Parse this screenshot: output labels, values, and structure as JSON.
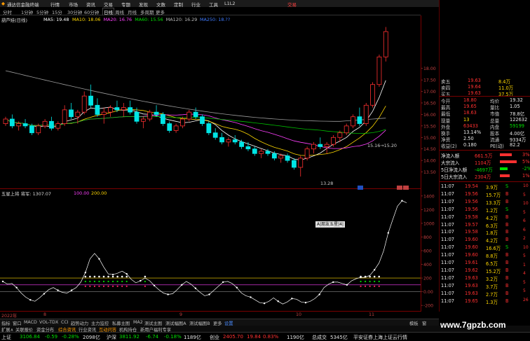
{
  "title_bar": {
    "app_title": "通达信金融终端",
    "menus": [
      "行情",
      "市场",
      "资讯",
      "交易",
      "专题",
      "发现",
      "文数",
      "定制",
      "行业",
      "工具",
      "L1L2"
    ],
    "trade": "交易"
  },
  "period_bar": {
    "items": [
      "分时",
      "1分钟",
      "5分钟",
      "15分",
      "30分钟",
      "60分钟",
      "日线",
      "周线",
      "月线",
      "多周期",
      "更多"
    ],
    "active": "日线"
  },
  "ma_legend": {
    "name": "葫芦娃(日线)",
    "items": [
      {
        "text": "MA5: 19.48",
        "color": "#ffffff"
      },
      {
        "text": "MA10: 18.06",
        "color": "#ffd800"
      },
      {
        "text": "MA20: 16.76",
        "color": "#ff40ff"
      },
      {
        "text": "MA60: 15.56",
        "color": "#00e000"
      },
      {
        "text": "MA120: 16.29",
        "color": "#bbbbbb"
      },
      {
        "text": "MA250: 18.??",
        "color": "#3f7bff"
      }
    ]
  },
  "main_chart": {
    "low_label": "13.28",
    "range_label": "15.16→15.20",
    "price_ticks": [
      "18.00",
      "17.50",
      "17.00",
      "16.50",
      "16.00",
      "15.50",
      "15.00",
      "14.50",
      "14.00",
      "13.50"
    ],
    "candles": [
      [
        15.6,
        15.9,
        15.5,
        15.8
      ],
      [
        15.8,
        16.0,
        15.4,
        15.5
      ],
      [
        15.5,
        15.7,
        15.3,
        15.6
      ],
      [
        15.6,
        15.8,
        15.4,
        15.5
      ],
      [
        15.5,
        15.6,
        15.1,
        15.2
      ],
      [
        15.2,
        15.6,
        15.1,
        15.5
      ],
      [
        15.5,
        15.8,
        15.4,
        15.7
      ],
      [
        15.7,
        15.9,
        15.3,
        15.4
      ],
      [
        15.4,
        15.7,
        15.3,
        15.6
      ],
      [
        15.6,
        16.4,
        15.5,
        16.2
      ],
      [
        16.2,
        16.5,
        15.8,
        15.9
      ],
      [
        15.9,
        16.2,
        15.6,
        16.1
      ],
      [
        16.1,
        17.0,
        16.0,
        16.8
      ],
      [
        16.8,
        17.3,
        16.3,
        16.4
      ],
      [
        16.4,
        16.7,
        15.9,
        16.0
      ],
      [
        16.0,
        16.3,
        15.6,
        16.1
      ],
      [
        16.1,
        16.4,
        15.9,
        16.3
      ],
      [
        16.3,
        16.6,
        16.1,
        16.2
      ],
      [
        16.2,
        16.5,
        15.9,
        16.3
      ],
      [
        16.3,
        16.6,
        16.0,
        16.1
      ],
      [
        16.1,
        16.3,
        15.6,
        15.7
      ],
      [
        15.7,
        15.9,
        15.4,
        15.8
      ],
      [
        15.8,
        16.2,
        15.7,
        16.1
      ],
      [
        16.1,
        16.4,
        15.9,
        16.0
      ],
      [
        16.0,
        16.1,
        15.5,
        15.6
      ],
      [
        15.6,
        15.7,
        15.2,
        15.3
      ],
      [
        15.3,
        15.6,
        15.2,
        15.5
      ],
      [
        15.5,
        15.9,
        15.4,
        15.8
      ],
      [
        15.8,
        16.2,
        15.7,
        16.1
      ],
      [
        16.1,
        16.3,
        15.8,
        15.9
      ],
      [
        15.9,
        16.0,
        15.5,
        15.6
      ],
      [
        15.6,
        15.7,
        15.1,
        15.2
      ],
      [
        15.2,
        15.4,
        14.9,
        15.0
      ],
      [
        15.0,
        15.2,
        14.7,
        14.8
      ],
      [
        14.8,
        15.0,
        14.6,
        14.9
      ],
      [
        14.9,
        15.1,
        14.7,
        14.8
      ],
      [
        14.8,
        14.9,
        14.5,
        14.6
      ],
      [
        14.6,
        14.8,
        14.4,
        14.5
      ],
      [
        14.5,
        14.6,
        14.2,
        14.3
      ],
      [
        14.3,
        14.5,
        14.1,
        14.4
      ],
      [
        14.4,
        14.5,
        14.2,
        14.3
      ],
      [
        14.3,
        14.4,
        14.0,
        14.1
      ],
      [
        14.1,
        14.3,
        13.9,
        14.2
      ],
      [
        14.2,
        14.3,
        13.9,
        14.0
      ],
      [
        14.0,
        14.1,
        13.6,
        13.7
      ],
      [
        13.7,
        14.2,
        13.3,
        14.1
      ],
      [
        14.1,
        14.6,
        14.0,
        14.5
      ],
      [
        14.5,
        14.8,
        14.3,
        14.7
      ],
      [
        14.7,
        15.0,
        14.5,
        14.6
      ],
      [
        14.6,
        14.8,
        14.3,
        14.7
      ],
      [
        14.7,
        15.1,
        14.6,
        15.0
      ],
      [
        15.0,
        15.3,
        14.8,
        15.2
      ],
      [
        15.2,
        15.6,
        15.1,
        15.5
      ],
      [
        15.5,
        16.0,
        15.4,
        15.9
      ],
      [
        15.9,
        16.3,
        15.5,
        15.6
      ],
      [
        15.6,
        16.5,
        15.5,
        16.4
      ],
      [
        16.4,
        17.4,
        16.3,
        17.3
      ],
      [
        17.3,
        18.6,
        17.2,
        18.5
      ],
      [
        18.5,
        19.8,
        18.3,
        19.6
      ]
    ]
  },
  "sub_chart": {
    "name": "五星上将",
    "label_1": "将军: 1307.07",
    "label_2": "100.00",
    "label_3": "200.00",
    "label_4": "0.00",
    "popup": "A|朋友五星|4|",
    "ticks": [
      "1400",
      "1200",
      "1000",
      "800",
      "600",
      "400",
      "200",
      "0.00",
      "-200"
    ],
    "values": [
      150,
      110,
      120,
      60,
      -20,
      -80,
      -120,
      -140,
      -90,
      -30,
      30,
      60,
      20,
      -10,
      -20,
      20,
      60,
      140,
      280,
      480,
      560,
      480,
      360,
      260,
      250,
      270,
      300,
      260,
      180,
      130,
      160,
      200,
      160,
      90,
      30,
      -20,
      -40,
      -30,
      30,
      100,
      150,
      110,
      50,
      -10,
      -60,
      -40,
      20,
      80,
      140,
      150,
      120,
      60,
      -20,
      -60,
      -80,
      -120,
      -160,
      -170,
      -140,
      -90,
      -140,
      -180,
      -150,
      -100,
      -110,
      -150,
      -160,
      -140,
      -100,
      -40,
      60,
      110,
      140,
      140,
      120,
      100,
      160,
      190,
      210,
      210,
      240,
      320,
      420,
      600,
      860,
      1060,
      1250,
      1330,
      1300
    ]
  },
  "date_axis": [
    "2022年",
    "8",
    "9",
    "10",
    "11"
  ],
  "bottom_tabs": [
    "指标",
    "窗口",
    "MACD",
    "VOL-TDX",
    "CCI",
    "趋势动力",
    "主力监控",
    "私募主图",
    "MA2",
    "测试主图",
    "测试幅图A",
    "测试幅图B",
    "更多",
    "设置"
  ],
  "tools_bar": [
    "扩展∧",
    "关联报价",
    "资金分布",
    "综合资讯",
    "行业资讯",
    "互动问答",
    "机构持仓",
    "新用户福利专享"
  ],
  "right_tabs": [
    "模板",
    "窗"
  ],
  "quote": {
    "order_book": [
      {
        "label": "卖五",
        "price": "19.63",
        "vol": "8.4万"
      },
      {
        "label": "卖四",
        "price": "19.64",
        "vol": "11.0万"
      },
      {
        "label": "买五",
        "price": "19.63",
        "vol": "37.5万"
      }
    ],
    "stats": [
      {
        "k1": "今开",
        "v1": "18.80",
        "k2": "均价",
        "v2": "19.32"
      },
      {
        "k1": "最高",
        "v1": "19.65",
        "k2": "量比",
        "v2": "1.05"
      },
      {
        "k1": "最低",
        "v1": "18.63",
        "k2": "市值",
        "v2": "78.8亿"
      },
      {
        "k1": "现量",
        "v1": "13",
        "k2": "总量",
        "v2": "122632"
      },
      {
        "k1": "外盘",
        "v1": "63433",
        "k2": "内盘",
        "v2": "59199"
      },
      {
        "k1": "换手",
        "v1": "13.14%",
        "k2": "股本",
        "v2": "4.00亿"
      },
      {
        "k1": "净资",
        "v1": "2.50",
        "k2": "流通",
        "v2": "9334万"
      },
      {
        "k1": "收益(2)",
        "v1": "0.180",
        "k2": "PE(动)",
        "v2": "82.2"
      }
    ],
    "flows": [
      {
        "label": "净流入额",
        "value": "661.5万",
        "pct": "3%",
        "bar": 0.55
      },
      {
        "label": "大宗流入",
        "value": "1104万",
        "pct": "5%",
        "bar": 0.8
      },
      {
        "label": "5日净流入额",
        "value": "-4697万",
        "pct": "-2%",
        "bar": 0.35
      },
      {
        "label": "5日大宗流入",
        "value": "2304万",
        "pct": "1%",
        "bar": 0.45
      }
    ],
    "ticks": [
      {
        "t": "11:07",
        "p": "19.54",
        "v": "3.9万",
        "s": "S"
      },
      {
        "t": "11:07",
        "p": "19.56",
        "v": "15.7万",
        "s": "B"
      },
      {
        "t": "11:07",
        "p": "19.56",
        "v": "13.3万",
        "s": "B"
      },
      {
        "t": "11:07",
        "p": "19.56",
        "v": "1.2万",
        "s": "S"
      },
      {
        "t": "11:07",
        "p": "19.58",
        "v": "4.2万",
        "s": "B"
      },
      {
        "t": "11:07",
        "p": "19.57",
        "v": "6.3万",
        "s": "B"
      },
      {
        "t": "11:07",
        "p": "19.58",
        "v": "1.8万",
        "s": "B"
      },
      {
        "t": "11:07",
        "p": "19.60",
        "v": "4.2万",
        "s": "B"
      },
      {
        "t": "11:07",
        "p": "19.60",
        "v": "16.6万",
        "s": "S"
      },
      {
        "t": "11:07",
        "p": "19.60",
        "v": "8.8万",
        "s": "B"
      },
      {
        "t": "11:07",
        "p": "19.61",
        "v": "6.5万",
        "s": "B"
      },
      {
        "t": "11:07",
        "p": "19.62",
        "v": "15.2万",
        "s": "B"
      },
      {
        "t": "11:07",
        "p": "19.63",
        "v": "3.2万",
        "s": "B"
      },
      {
        "t": "11:07",
        "p": "19.63",
        "v": "3.7万",
        "s": "B"
      },
      {
        "t": "11:07",
        "p": "19.63",
        "v": "2.7万",
        "s": "B"
      },
      {
        "t": "11:07",
        "p": "19.65",
        "v": "1.3万",
        "s": "B"
      }
    ],
    "side_nums": [
      "10",
      "5",
      "10",
      "5",
      "6",
      "6",
      "2",
      "10",
      "5",
      "1",
      "4",
      "5",
      "5",
      "26"
    ]
  },
  "status_bar": {
    "items": [
      {
        "text": "上证",
        "color": "#e0e0e0"
      },
      {
        "text": "3106.84",
        "color": "#00e000"
      },
      {
        "text": "-0.59",
        "color": "#00e000"
      },
      {
        "text": "-0.28%",
        "color": "#00e000"
      },
      {
        "text": "2098亿",
        "color": "#e0e0e0"
      },
      {
        "text": "沪深",
        "color": "#e0e0e0"
      },
      {
        "text": "3811.92",
        "color": "#00e000"
      },
      {
        "text": "-6.74",
        "color": "#00e000"
      },
      {
        "text": "-0.18%",
        "color": "#00e000"
      },
      {
        "text": "1189亿",
        "color": "#e0e0e0"
      },
      {
        "text": "创业",
        "color": "#e0e0e0"
      },
      {
        "text": "2405.70",
        "color": "#ff3030"
      },
      {
        "text": "19.84",
        "color": "#ff3030"
      },
      {
        "text": "0.83%",
        "color": "#ff3030"
      },
      {
        "text": "1190亿",
        "color": "#e0e0e0"
      },
      {
        "text": "总成交",
        "color": "#e0e0e0"
      },
      {
        "text": "5345亿",
        "color": "#e0e0e0"
      },
      {
        "text": "平安证券上海上证云行情",
        "color": "#e0e0e0"
      }
    ]
  },
  "watermark": "www.7gpzb.com"
}
